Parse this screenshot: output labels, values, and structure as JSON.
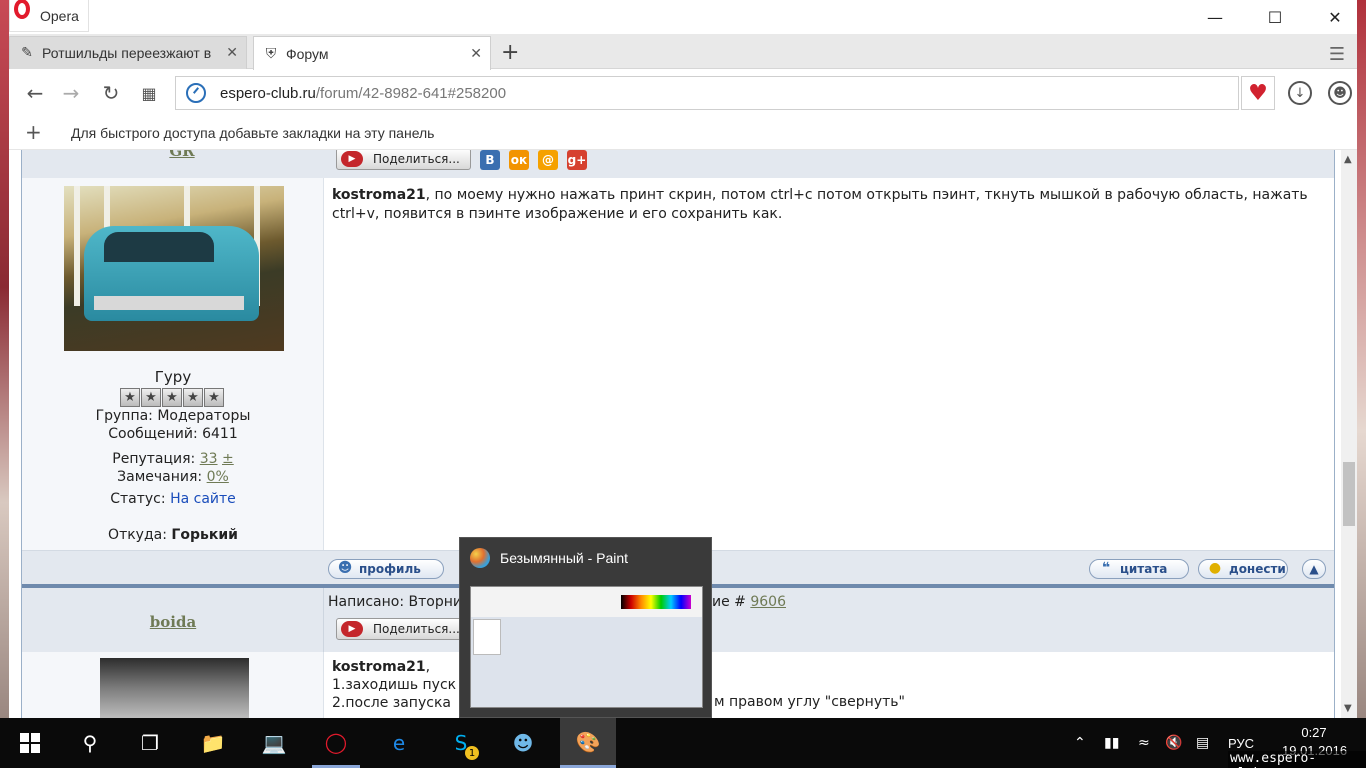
{
  "browser": {
    "app_name": "Opera",
    "tabs": [
      {
        "title": "Ротшильды переезжают в",
        "icon": "document-icon",
        "active": false
      },
      {
        "title": "Форум",
        "icon": "shield-icon",
        "active": true
      }
    ],
    "address": {
      "host": "espero-club.ru",
      "path": "/forum/42-8982-641#258200"
    },
    "bookmarks_hint": "Для быстрого доступа добавьте закладки на эту панель"
  },
  "page": {
    "share_label": "Поделиться...",
    "top_user": "GR",
    "post1": {
      "author": "kostroma21",
      "text": ", по моему нужно нажать принт скрин, потом ctrl+c потом открыть пэинт, ткнуть мышкой в рабочую область, нажать ctrl+v, появится в пэинте изображение и его сохранить как.",
      "rank": "Гуру",
      "group": "Группа: Модераторы",
      "messages": "Сообщений: 6411",
      "reputation_label": "Репутация:",
      "reputation_value": "33",
      "reputation_pm": "±",
      "warnings_label": "Замечания:",
      "warnings_value": "0%",
      "status_label": "Статус:",
      "status_value": "На сайте",
      "from_label": "Откуда:",
      "from_value": "Горький"
    },
    "actions": {
      "profile": "профиль",
      "quote": "цитата",
      "report": "донести"
    },
    "post2": {
      "user": "boida",
      "written_prefix": "Написано: Вторни",
      "written_suffix": "ие #",
      "post_number": "9606",
      "author": "kostroma21",
      "line1": "1.заходишь пуск",
      "line2": "2.после запуска",
      "line2_right": "м правом углу \"свернуть\""
    }
  },
  "preview": {
    "title": "Безымянный - Paint"
  },
  "taskbar": {
    "skype_badge": "1",
    "language": "РУС",
    "time": "0:27",
    "date": "19.01.2016",
    "watermark": "www.espero-club.ru"
  }
}
